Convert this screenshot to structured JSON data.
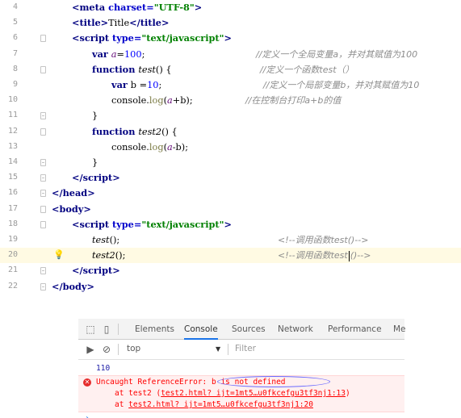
{
  "editor": {
    "lines": [
      {
        "num": "4"
      },
      {
        "num": "5"
      },
      {
        "num": "6"
      },
      {
        "num": "7",
        "comment": "//定义一个全局变量a，并对其赋值为100"
      },
      {
        "num": "8",
        "comment": "//定义一个函数test（）"
      },
      {
        "num": "9",
        "comment": "//定义一个局部变量b，并对其赋值为10"
      },
      {
        "num": "10",
        "comment": "//在控制台打印a+b的值"
      },
      {
        "num": "11"
      },
      {
        "num": "12"
      },
      {
        "num": "13"
      },
      {
        "num": "14"
      },
      {
        "num": "15"
      },
      {
        "num": "16"
      },
      {
        "num": "17"
      },
      {
        "num": "18"
      },
      {
        "num": "19",
        "comment": "<!--调用函数test()-->"
      },
      {
        "num": "20",
        "comment_a": "<!--调用函数test",
        "comment_b": "()-->"
      },
      {
        "num": "21"
      },
      {
        "num": "22"
      }
    ]
  },
  "devtools": {
    "tabs": [
      "Elements",
      "Console",
      "Sources",
      "Network",
      "Performance",
      "Me"
    ],
    "active_tab": "Console",
    "context": "top",
    "filter_placeholder": "Filter",
    "log_value": "110",
    "error": {
      "prefix": "Uncaught ReferenceError: ",
      "message": "b is not defined",
      "stack": [
        {
          "at": "at test2 (",
          "link": "test2.html? ijt=1mt5…u0fkcefgu3tf3nj1:13",
          "close": ")"
        },
        {
          "at": "at ",
          "link": "test2.html? ijt=1mt5…u0fkcefgu3tf3nj1:20",
          "close": ""
        }
      ]
    },
    "prompt": "›"
  }
}
